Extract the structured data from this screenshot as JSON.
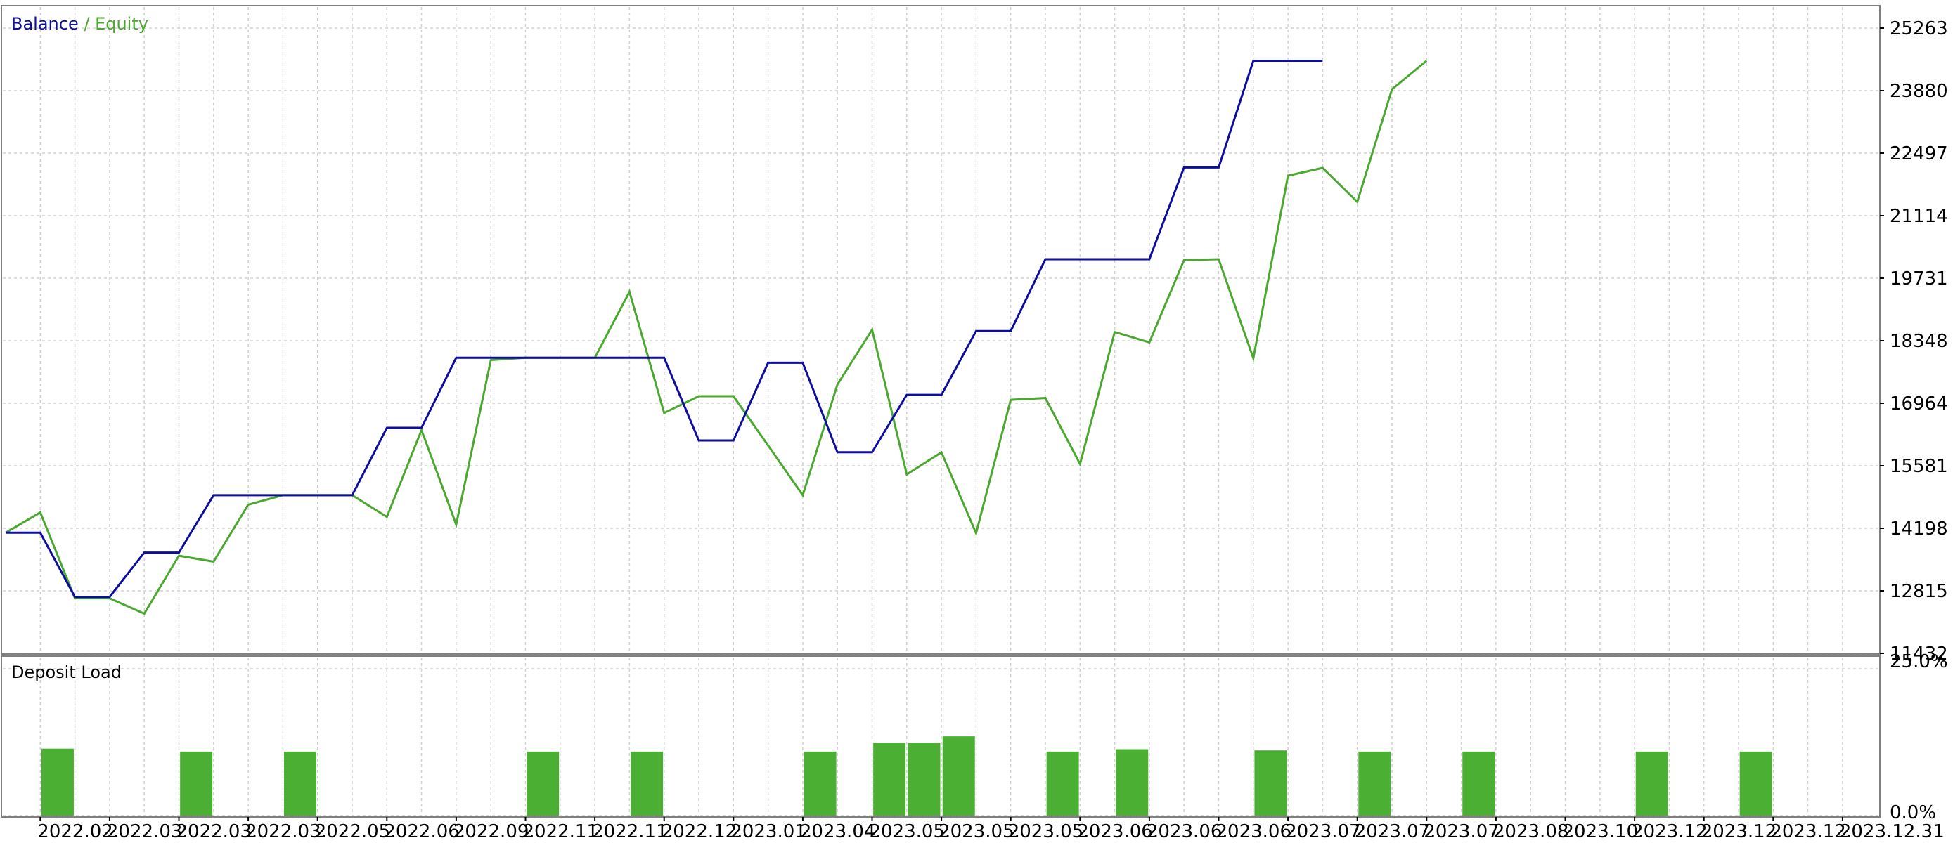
{
  "chart_data": [
    {
      "type": "line",
      "legend": {
        "placement": "top-left",
        "separator": " / "
      },
      "series": [
        {
          "name": "Balance",
          "color": "#0d0d9e",
          "values": [
            14100,
            14100,
            12680,
            12680,
            13660,
            13660,
            14930,
            14930,
            14930,
            14930,
            14930,
            16420,
            16420,
            17970,
            17970,
            17970,
            17970,
            17970,
            17970,
            17970,
            16140,
            16140,
            17860,
            17860,
            15880,
            15880,
            17150,
            17150,
            18560,
            18560,
            20150,
            20150,
            20150,
            20150,
            22180,
            22180,
            24540,
            24540,
            24540
          ]
        },
        {
          "name": "Equity",
          "color": "#4aa82f",
          "values": [
            14100,
            14550,
            12650,
            12650,
            12310,
            13590,
            13460,
            14720,
            14930,
            14930,
            14930,
            14450,
            16370,
            14280,
            17920,
            17970,
            17970,
            17970,
            19430,
            16750,
            17120,
            17120,
            16030,
            14930,
            17380,
            18590,
            15390,
            15880,
            14090,
            17040,
            17080,
            15620,
            18540,
            18310,
            20130,
            20150,
            17960,
            22000,
            22170,
            21420,
            23910,
            24540
          ]
        }
      ],
      "ylim": [
        11432,
        25263
      ],
      "yticks": [
        "25263",
        "23880",
        "22497",
        "21114",
        "19731",
        "18348",
        "16964",
        "15581",
        "14198",
        "12815",
        "11432"
      ],
      "grid": true
    },
    {
      "type": "bar",
      "title": "Deposit Load",
      "color": "#4aaf33",
      "ylim": [
        0,
        25
      ],
      "yticks": [
        "25.0%",
        "0.0%"
      ],
      "bars": [
        {
          "x": 1.5,
          "value": 11.4
        },
        {
          "x": 5.5,
          "value": 10.9
        },
        {
          "x": 8.5,
          "value": 10.9
        },
        {
          "x": 15.5,
          "value": 10.9
        },
        {
          "x": 18.5,
          "value": 10.9
        },
        {
          "x": 23.5,
          "value": 10.9
        },
        {
          "x": 25.5,
          "value": 12.4
        },
        {
          "x": 26.5,
          "value": 12.4
        },
        {
          "x": 27.5,
          "value": 13.5
        },
        {
          "x": 30.5,
          "value": 10.9
        },
        {
          "x": 32.5,
          "value": 11.3
        },
        {
          "x": 36.5,
          "value": 11.1
        },
        {
          "x": 39.5,
          "value": 10.9
        },
        {
          "x": 42.5,
          "value": 10.9
        },
        {
          "x": 47.5,
          "value": 10.9
        },
        {
          "x": 50.5,
          "value": 10.9
        }
      ],
      "grid": true
    }
  ],
  "x_axis": {
    "labels": [
      "2022.02.",
      "2022.03.",
      "2022.03.",
      "2022.03.",
      "2022.05.",
      "2022.06.",
      "2022.09.",
      "2022.11.",
      "2022.11.",
      "2022.12.",
      "2023.01.",
      "2023.04.",
      "2023.05.",
      "2023.05.",
      "2023.05.",
      "2023.06.",
      "2023.06.",
      "2023.06.",
      "2023.07.",
      "2023.07.",
      "2023.07.",
      "2023.08.",
      "2023.10.",
      "2023.12.",
      "2023.12.",
      "2023.12.",
      "2023.12.31"
    ]
  }
}
